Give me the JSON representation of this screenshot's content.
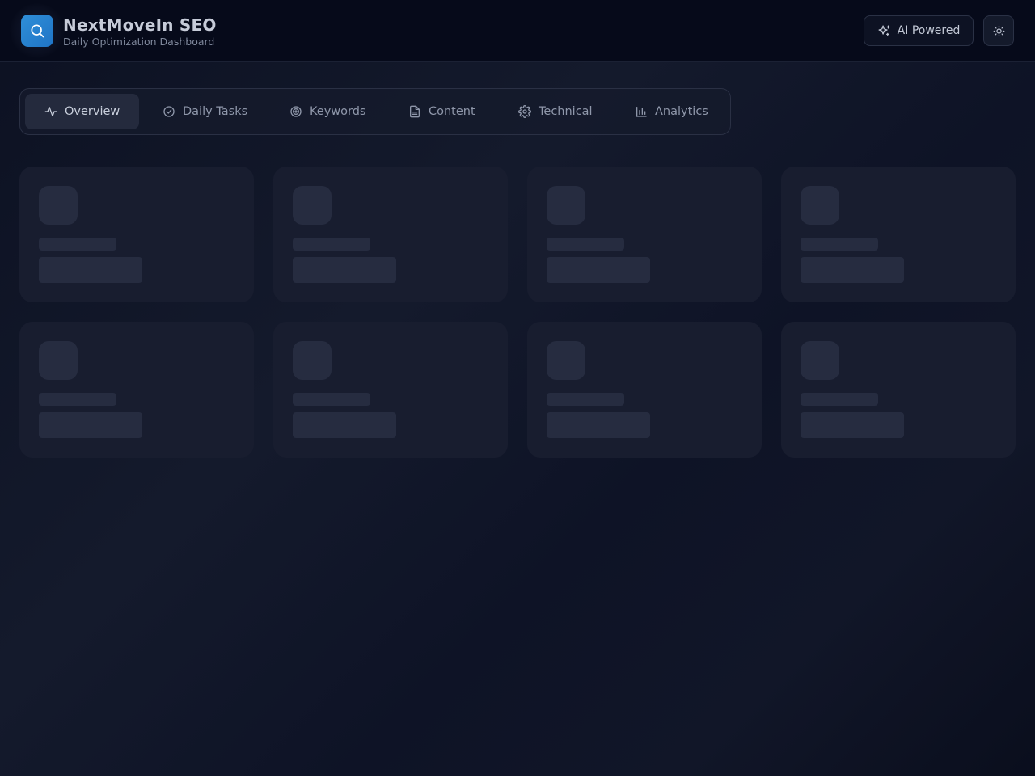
{
  "header": {
    "title": "NextMoveIn SEO",
    "subtitle": "Daily Optimization Dashboard",
    "logo_icon": "search-icon",
    "ai_button_label": "AI Powered",
    "ai_button_icon": "sparkles-icon",
    "theme_button_icon": "sun-icon"
  },
  "tabs": [
    {
      "label": "Overview",
      "icon": "activity-icon",
      "active": true
    },
    {
      "label": "Daily Tasks",
      "icon": "check-circle-icon",
      "active": false
    },
    {
      "label": "Keywords",
      "icon": "target-icon",
      "active": false
    },
    {
      "label": "Content",
      "icon": "file-text-icon",
      "active": false
    },
    {
      "label": "Technical",
      "icon": "gear-icon",
      "active": false
    },
    {
      "label": "Analytics",
      "icon": "bar-chart-icon",
      "active": false
    }
  ],
  "colors": {
    "accent": "#2f8fd8",
    "background": "#0b1020",
    "skeleton": "#262c40"
  }
}
